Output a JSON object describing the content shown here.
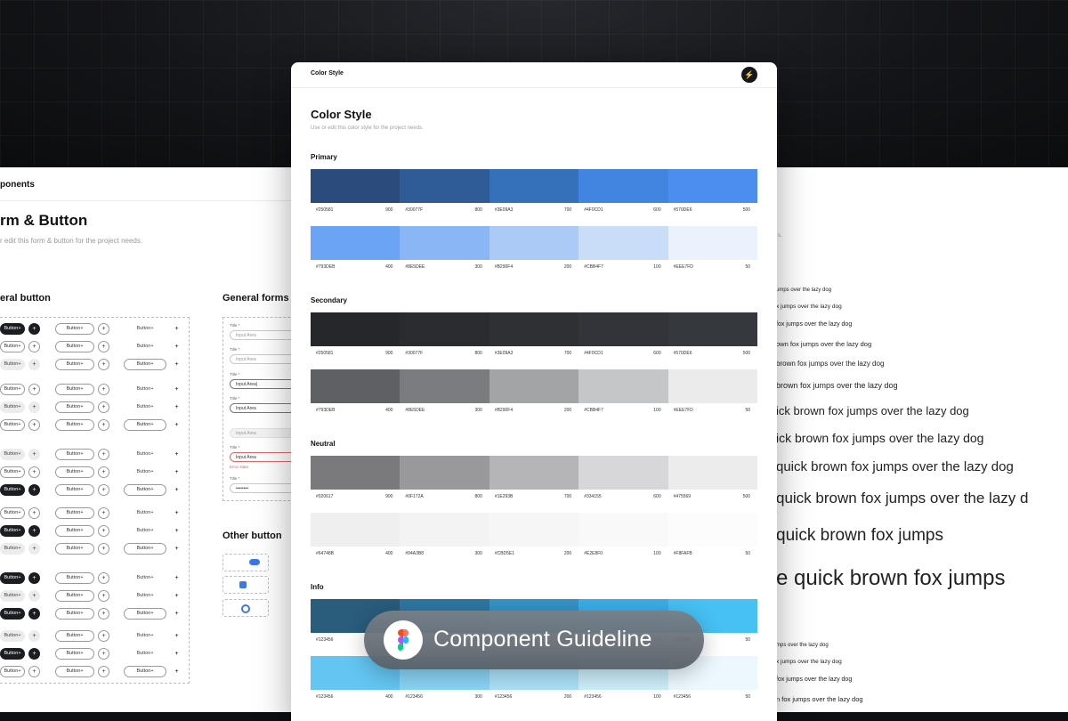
{
  "background": {
    "color": "#0e0f12"
  },
  "left_panel": {
    "header": "ponents",
    "title": "rm & Button",
    "subtitle": "r edit this form & button for the project needs.",
    "general_button": "eral button",
    "general_forms": "General forms",
    "other_button": "Other button",
    "button_label": "Button",
    "forms": {
      "title_label": "Title *",
      "input_area": "Input Area",
      "input_area_dot": "Input Area|",
      "error_text": "Error state",
      "password": "••••••••"
    }
  },
  "card": {
    "header": "Color Style",
    "title": "Color Style",
    "subtitle": "Use or edit this color style for the project needs.",
    "sections": [
      {
        "name": "Primary",
        "rows": [
          {
            "colors": [
              "#2a4b7c",
              "#2f5c96",
              "#3570ba",
              "#4285e0",
              "#4c8ef0"
            ],
            "labels": [
              [
                "#250581",
                "900"
              ],
              [
                "#30077F",
                "800"
              ],
              [
                "#3E09A3",
                "700"
              ],
              [
                "#4F0CD1",
                "600"
              ],
              [
                "#570DE6",
                "500"
              ]
            ]
          },
          {
            "colors": [
              "#6ba3f5",
              "#8ab6f6",
              "#abcbf6",
              "#c9dcf8",
              "#ebf2fd"
            ],
            "labels": [
              [
                "#793DEB",
                "400"
              ],
              [
                "#8E5DEE",
                "300"
              ],
              [
                "#B290F4",
                "200"
              ],
              [
                "#CBB4F7",
                "100"
              ],
              [
                "#EEE7FD",
                "50"
              ]
            ]
          }
        ]
      },
      {
        "name": "Secondary",
        "rows": [
          {
            "colors": [
              "#26272b",
              "#2b2c30",
              "#2e3034",
              "#323439",
              "#35383d"
            ],
            "labels": [
              [
                "#250581",
                "900"
              ],
              [
                "#30077F",
                "800"
              ],
              [
                "#3E09A3",
                "700"
              ],
              [
                "#4F0CD1",
                "600"
              ],
              [
                "#570DE6",
                "500"
              ]
            ]
          },
          {
            "colors": [
              "#5f6063",
              "#7b7c7f",
              "#a3a4a6",
              "#c5c6c7",
              "#ebebec"
            ],
            "labels": [
              [
                "#793DEB",
                "400"
              ],
              [
                "#8E5DEE",
                "300"
              ],
              [
                "#B290F4",
                "200"
              ],
              [
                "#CBB4F7",
                "100"
              ],
              [
                "#EEE7FD",
                "50"
              ]
            ]
          }
        ]
      },
      {
        "name": "Neutral",
        "rows": [
          {
            "colors": [
              "#7a7a7c",
              "#99999b",
              "#b5b5b7",
              "#d7d7d9",
              "#ececed"
            ],
            "labels": [
              [
                "#020617",
                "900"
              ],
              [
                "#0F172A",
                "800"
              ],
              [
                "#1E293B",
                "700"
              ],
              [
                "#334155",
                "600"
              ],
              [
                "#475569",
                "500"
              ]
            ]
          },
          {
            "colors": [
              "#efeff0",
              "#f3f3f4",
              "#f6f6f7",
              "#f9f9fa",
              "#fcfcfd"
            ],
            "labels": [
              [
                "#64748B",
                "400"
              ],
              [
                "#94A3B8",
                "300"
              ],
              [
                "#CBD5E1",
                "200"
              ],
              [
                "#E2E8F0",
                "100"
              ],
              [
                "#F8FAFB",
                "50"
              ]
            ]
          }
        ]
      },
      {
        "name": "Info",
        "rows": [
          {
            "colors": [
              "#2a5c7c",
              "#2e77a3",
              "#3493c7",
              "#3aaee8",
              "#47c0f3"
            ],
            "labels": [
              [
                "#123456",
                "400"
              ],
              [
                "#123456",
                "300"
              ],
              [
                "#123456",
                "200"
              ],
              [
                "#123456",
                "100"
              ],
              [
                "#123456",
                "50"
              ]
            ]
          },
          {
            "colors": [
              "#64c5f2",
              "#8ad4f5",
              "#ace1f8",
              "#cdeefa",
              "#ecf8fe"
            ],
            "labels": [
              [
                "#123456",
                "400"
              ],
              [
                "#123456",
                "300"
              ],
              [
                "#123456",
                "200"
              ],
              [
                "#123456",
                "100"
              ],
              [
                "#123456",
                "50"
              ]
            ]
          }
        ]
      }
    ]
  },
  "badge": {
    "text": "Component Guideline",
    "logo": "figma-logo-icon"
  },
  "right_panel": {
    "subtitle": "s.",
    "lines": [
      {
        "text": "umps over the lazy dog"
      },
      {
        "text": "x jumps over the lazy dog"
      },
      {
        "text": "fox jumps over the lazy dog"
      },
      {
        "text": "own fox jumps over the lazy dog"
      },
      {
        "text": "brown fox jumps over the lazy dog"
      },
      {
        "text": "brown fox jumps over the lazy dog"
      },
      {
        "text": "ick brown fox jumps over the lazy dog"
      },
      {
        "text": "ick brown fox jumps over the lazy dog"
      },
      {
        "text": "quick brown fox jumps over the lazy dog"
      },
      {
        "text": "quick brown fox jumps over the lazy d"
      },
      {
        "text": "quick brown fox jumps"
      },
      {
        "text": "e quick brown fox jumps"
      },
      {
        "text": "mps over the lazy dog"
      },
      {
        "text": "x jumps over the lazy dog"
      },
      {
        "text": "fox jumps over the lazy dog"
      },
      {
        "text": "n fox jumps over the lazy dog"
      }
    ]
  }
}
